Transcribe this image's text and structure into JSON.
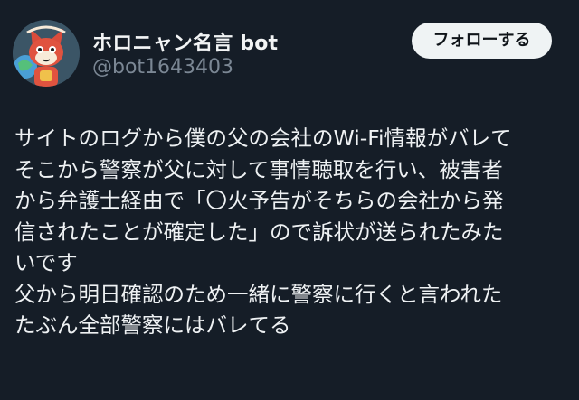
{
  "author": {
    "display_name": "ホロニャン名言 bot",
    "handle": "@bot1643403",
    "avatar_icon": "cat-character-avatar"
  },
  "follow_button": {
    "label": "フォローする"
  },
  "tweet": {
    "lines": [
      "サイトのログから僕の父の会社のWi-Fi情報がバレて",
      "そこから警察が父に対して事情聴取を行い、被害者",
      "から弁護士経由で「〇火予告がそちらの会社から発",
      "信されたことが確定した」ので訴状が送られたみた",
      "いです",
      "父から明日確認のため一緒に警察に行くと言われた",
      "たぶん全部警察にはバレてる"
    ]
  },
  "colors": {
    "background": "#151d27",
    "text": "#eef1f3",
    "handle": "#7b8794",
    "button_bg": "#eff3f4",
    "button_text": "#0f1419"
  }
}
